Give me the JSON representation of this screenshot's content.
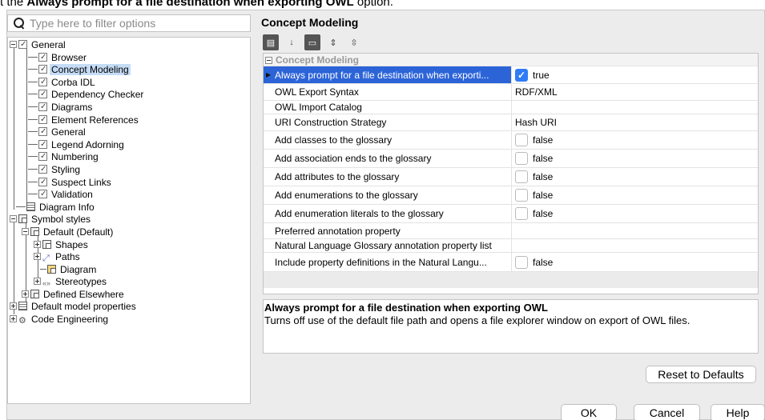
{
  "doc": {
    "prefix": "t the ",
    "option": "Always prompt for a file destination when exporting OWL",
    "suffix": " option."
  },
  "filter": {
    "placeholder": "Type here to filter options",
    "value": ""
  },
  "tree": [
    "General",
    "Browser",
    "Concept Modeling",
    "Corba IDL",
    "Dependency Checker",
    "Diagrams",
    "Element References",
    "General",
    "Legend Adorning",
    "Numbering",
    "Styling",
    "Suspect Links",
    "Validation",
    "Diagram Info",
    "Symbol styles",
    "Default (Default)",
    "Shapes",
    "Paths",
    "Diagram",
    "Stereotypes",
    "Defined Elsewhere",
    "Default model properties",
    "Code Engineering"
  ],
  "section_title": "Concept Modeling",
  "grid": {
    "category": "Concept Modeling",
    "rows": [
      {
        "name": "Always prompt for a file destination when exporti...",
        "value": "true",
        "checkbox": true,
        "checked": true
      },
      {
        "name": "OWL Export Syntax",
        "value": "RDF/XML"
      },
      {
        "name": "OWL Import Catalog",
        "value": ""
      },
      {
        "name": "URI Construction Strategy",
        "value": "Hash URI"
      },
      {
        "name": "Add classes to the glossary",
        "value": "false",
        "checkbox": true
      },
      {
        "name": "Add association ends to the glossary",
        "value": "false",
        "checkbox": true
      },
      {
        "name": "Add attributes to the glossary",
        "value": "false",
        "checkbox": true
      },
      {
        "name": "Add enumerations to the glossary",
        "value": "false",
        "checkbox": true
      },
      {
        "name": "Add enumeration literals to the glossary",
        "value": "false",
        "checkbox": true
      },
      {
        "name": "Preferred annotation property",
        "value": ""
      },
      {
        "name": "Natural Language Glossary annotation property list",
        "value": ""
      },
      {
        "name": "Include property definitions in the Natural Langu...",
        "value": "false",
        "checkbox": true
      }
    ]
  },
  "description": {
    "title": "Always prompt for a file destination when exporting OWL",
    "body": "Turns off use of the default file path and opens a file explorer window on export of OWL files."
  },
  "buttons": {
    "reset": "Reset to Defaults",
    "ok": "OK",
    "cancel": "Cancel",
    "help": "Help"
  },
  "colors": {
    "selection": "#2c64d8",
    "tree_selection": "#c5dcf6",
    "checkbox_on": "#2f7cf6"
  }
}
